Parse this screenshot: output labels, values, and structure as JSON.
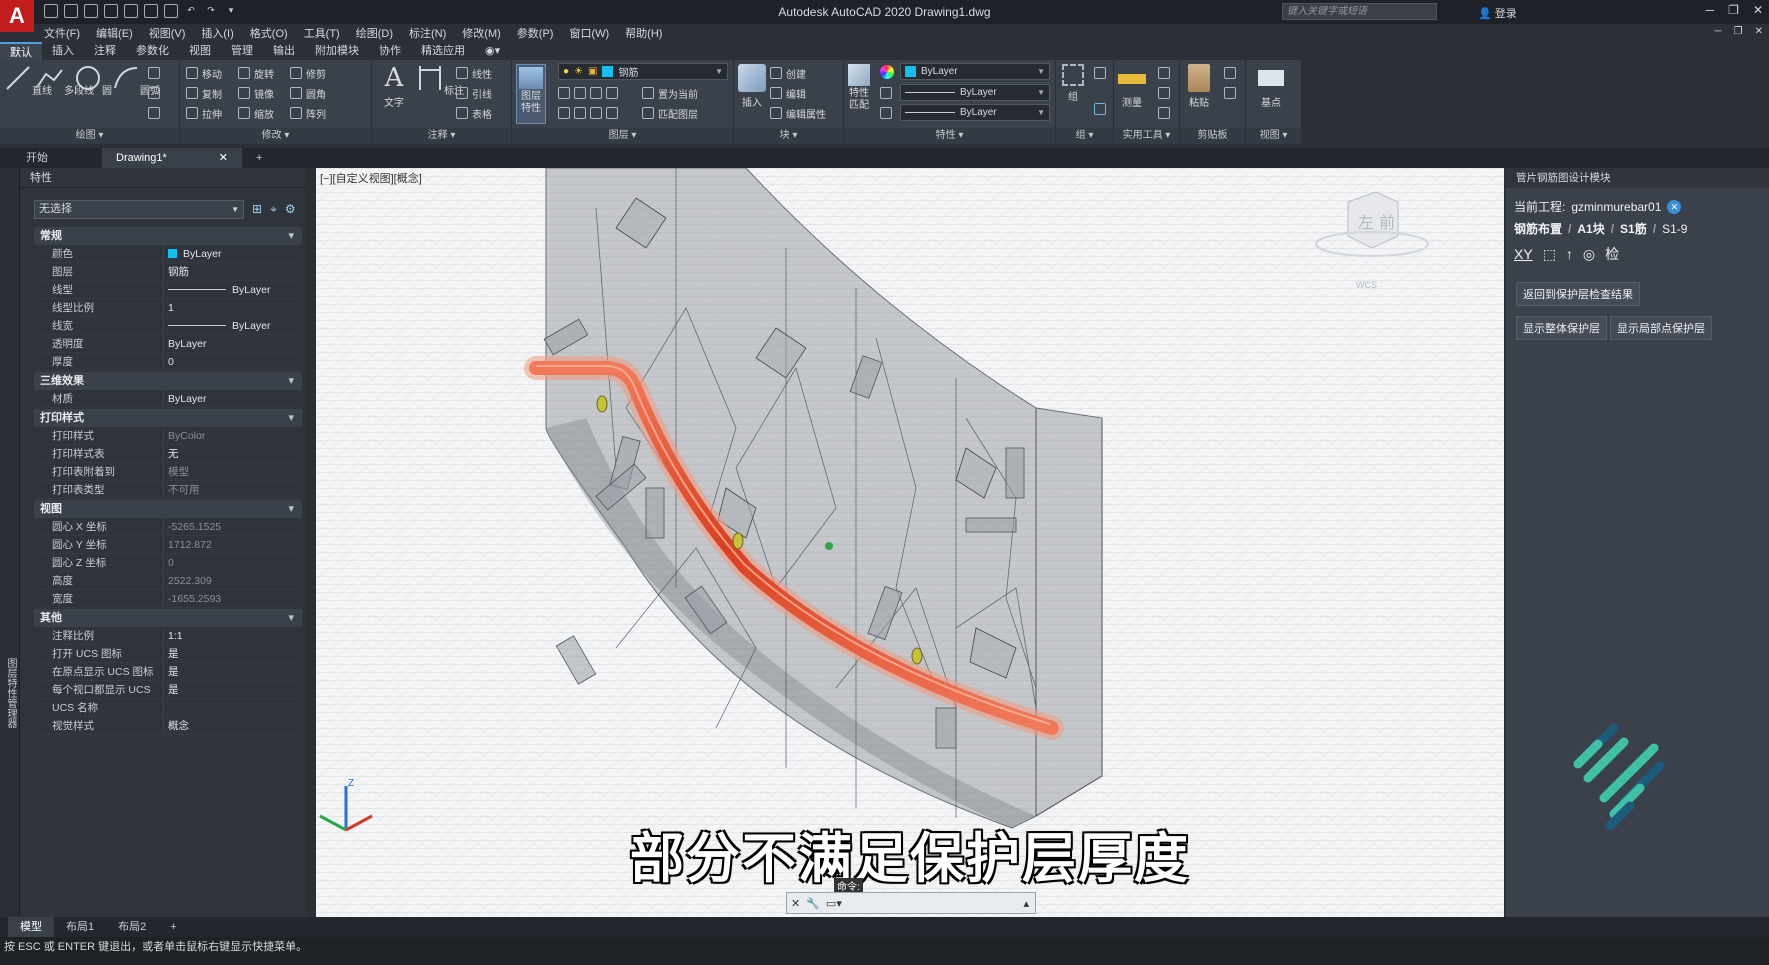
{
  "app": {
    "title": "Autodesk AutoCAD 2020   Drawing1.dwg",
    "search_placeholder": "键入关键字或短语",
    "login": "登录",
    "logo": "A"
  },
  "menu": [
    "文件(F)",
    "编辑(E)",
    "视图(V)",
    "插入(I)",
    "格式(O)",
    "工具(T)",
    "绘图(D)",
    "标注(N)",
    "修改(M)",
    "参数(P)",
    "窗口(W)",
    "帮助(H)"
  ],
  "ribbon_tabs": [
    "默认",
    "插入",
    "注释",
    "参数化",
    "视图",
    "管理",
    "输出",
    "附加模块",
    "协作",
    "精选应用"
  ],
  "ribbon": {
    "draw": {
      "title": "绘图 ▾",
      "tools": [
        "直线",
        "多段线",
        "圆",
        "圆弧"
      ]
    },
    "modify": {
      "title": "修改 ▾",
      "tools": [
        "移动",
        "旋转",
        "修剪",
        "复制",
        "镜像",
        "圆角",
        "拉伸",
        "缩放",
        "阵列"
      ]
    },
    "annotate": {
      "title": "注释 ▾",
      "tools": [
        "文字",
        "标注",
        "线性",
        "引线",
        "表格"
      ]
    },
    "layers": {
      "title": "图层 ▾",
      "big": "图层\n特性",
      "current_layer": "钢筋",
      "tools": [
        "置为当前",
        "匹配图层"
      ]
    },
    "block": {
      "title": "块 ▾",
      "tools": [
        "插入",
        "创建",
        "编辑",
        "编辑属性"
      ]
    },
    "properties": {
      "title": "特性 ▾",
      "big": "特性\n匹配",
      "color": "ByLayer",
      "linetype": "ByLayer",
      "lineweight": "ByLayer"
    },
    "groups": {
      "title": "组 ▾",
      "tools": [
        "组"
      ]
    },
    "utilities": {
      "title": "实用工具 ▾",
      "tools": [
        "测量"
      ]
    },
    "clipboard": {
      "title": "剪贴板",
      "tools": [
        "粘贴"
      ]
    },
    "view": {
      "title": "视图 ▾",
      "tools": [
        "基点"
      ]
    }
  },
  "doc_tabs": {
    "start": "开始",
    "drawing": "Drawing1*",
    "add": "+"
  },
  "properties_panel": {
    "header": "特性",
    "side_label": "图层特性管理器",
    "selection": "无选择",
    "sections": [
      {
        "name": "常规",
        "rows": [
          {
            "k": "颜色",
            "v": "ByLayer",
            "swatch": "#11c0f0"
          },
          {
            "k": "图层",
            "v": "钢筋"
          },
          {
            "k": "线型",
            "v": "ByLayer",
            "line": true
          },
          {
            "k": "线型比例",
            "v": "1"
          },
          {
            "k": "线宽",
            "v": "ByLayer",
            "line": true
          },
          {
            "k": "透明度",
            "v": "ByLayer"
          },
          {
            "k": "厚度",
            "v": "0"
          }
        ]
      },
      {
        "name": "三维效果",
        "rows": [
          {
            "k": "材质",
            "v": "ByLayer"
          }
        ]
      },
      {
        "name": "打印样式",
        "rows": [
          {
            "k": "打印样式",
            "v": "ByColor",
            "dim": true
          },
          {
            "k": "打印样式表",
            "v": "无"
          },
          {
            "k": "打印表附着到",
            "v": "模型",
            "dim": true
          },
          {
            "k": "打印表类型",
            "v": "不可用",
            "dim": true
          }
        ]
      },
      {
        "name": "视图",
        "rows": [
          {
            "k": "圆心 X 坐标",
            "v": "-5265.1525",
            "dim": true
          },
          {
            "k": "圆心 Y 坐标",
            "v": "1712.872",
            "dim": true
          },
          {
            "k": "圆心 Z 坐标",
            "v": "0",
            "dim": true
          },
          {
            "k": "高度",
            "v": "2522.309",
            "dim": true
          },
          {
            "k": "宽度",
            "v": "-1655.2593",
            "dim": true
          }
        ]
      },
      {
        "name": "其他",
        "rows": [
          {
            "k": "注释比例",
            "v": "1:1"
          },
          {
            "k": "打开 UCS 图标",
            "v": "是"
          },
          {
            "k": "在原点显示 UCS 图标",
            "v": "是"
          },
          {
            "k": "每个视口都显示 UCS",
            "v": "是"
          },
          {
            "k": "UCS 名称",
            "v": ""
          },
          {
            "k": "视觉样式",
            "v": "概念"
          }
        ]
      }
    ]
  },
  "viewport": {
    "label": "[−][自定义视图][概念]",
    "viewcube_text": "左  前",
    "wcs": "WCS",
    "subtitle": "部分不满足保护层厚度",
    "cmd_tip": "命令:",
    "cmd_placeholder": ""
  },
  "right_panel": {
    "header": "管片钢筋图设计模块",
    "project_label": "当前工程:",
    "project_name": "gzminmurebar01",
    "breadcrumb": [
      "钢筋布置",
      "A1块",
      "S1筋",
      "S1-9"
    ],
    "toolbar": [
      "XY",
      "检"
    ],
    "buttons": [
      "返回到保护层检查结果",
      "显示整体保护层",
      "显示局部点保护层"
    ]
  },
  "layout_tabs": [
    "模型",
    "布局1",
    "布局2",
    "+"
  ],
  "status_text": "按 ESC 或 ENTER 键退出，或者单击鼠标右键显示快捷菜单。",
  "colors": {
    "accent": "#4aa3df",
    "rebar": "#e8512f",
    "dark_bg": "#2b2f36"
  }
}
